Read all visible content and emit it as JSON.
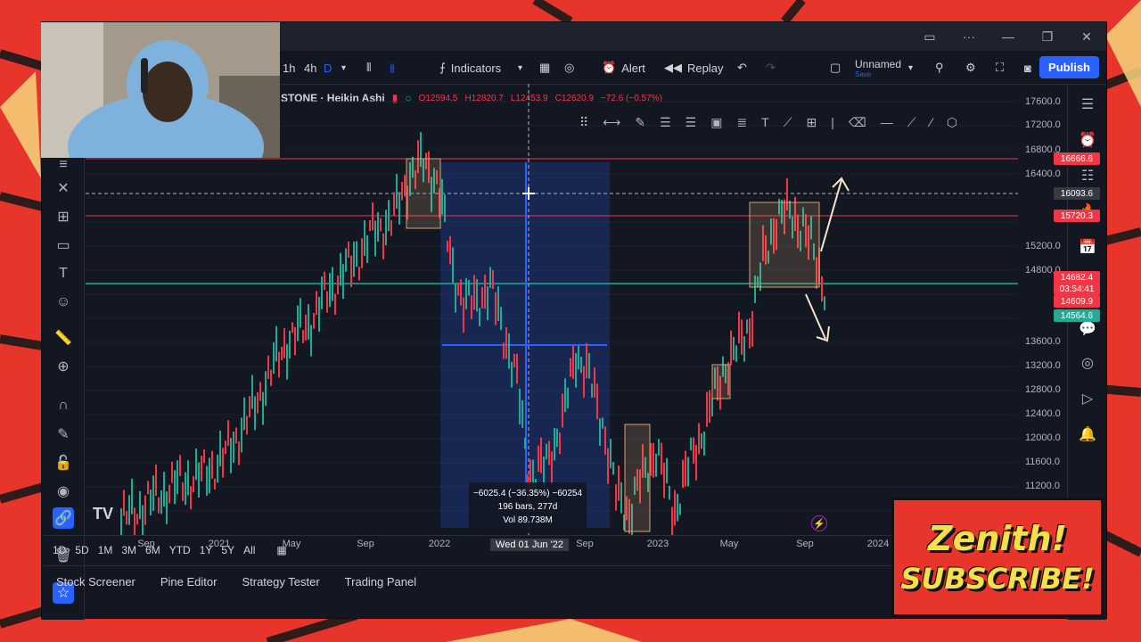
{
  "window": {
    "layout_name": "Unnamed",
    "layout_sub": "Save",
    "publish_label": "Publish"
  },
  "toolbar": {
    "interval_1h": "1h",
    "interval_4h": "4h",
    "interval_d": "D",
    "indicators_label": "Indicators",
    "alert_label": "Alert",
    "replay_label": "Replay"
  },
  "legend": {
    "symbol": "STONE · Heikin Ashi",
    "open": "O12594.5",
    "high": "H12820.7",
    "low": "L12453.9",
    "close": "C12620.9",
    "change": "−72.6 (−0.57%)"
  },
  "price_axis": {
    "ticks": [
      "17600.0",
      "17200.0",
      "16800.0",
      "16400.0",
      "15200.0",
      "14800.0",
      "13600.0",
      "13200.0",
      "12800.0",
      "12400.0",
      "12000.0",
      "11600.0",
      "11200.0"
    ],
    "badges": [
      {
        "text": "16666.6",
        "color": "#f23645"
      },
      {
        "text": "16093.6",
        "color": "#363a45"
      },
      {
        "text": "15720.3",
        "color": "#f23645"
      },
      {
        "text": "14682.4",
        "color": "#f23645"
      },
      {
        "text": "03:54:41",
        "color": "#f23645"
      },
      {
        "text": "14609.9",
        "color": "#f23645"
      },
      {
        "text": "14564.6",
        "color": "#22ab94"
      }
    ]
  },
  "time_axis": {
    "ticks": [
      "Sep",
      "2021",
      "May",
      "Sep",
      "2022",
      "Wed 01 Jun '22",
      "Sep",
      "2023",
      "May",
      "Sep",
      "2024"
    ]
  },
  "measure": {
    "change": "−6025.4 (−36.35%) −60254",
    "bars": "196 bars, 277d",
    "volume": "Vol 89.738M"
  },
  "ranges": [
    "1D",
    "5D",
    "1M",
    "3M",
    "6M",
    "YTD",
    "1Y",
    "5Y",
    "All"
  ],
  "panels": [
    "Stock Screener",
    "Pine Editor",
    "Strategy Tester",
    "Trading Panel"
  ],
  "promo": {
    "line1": "Zenith!",
    "line2": "SUBSCRIBE!"
  },
  "colors": {
    "up": "#22ab94",
    "down": "#f23645",
    "accent": "#2962ff",
    "background": "#131722"
  }
}
